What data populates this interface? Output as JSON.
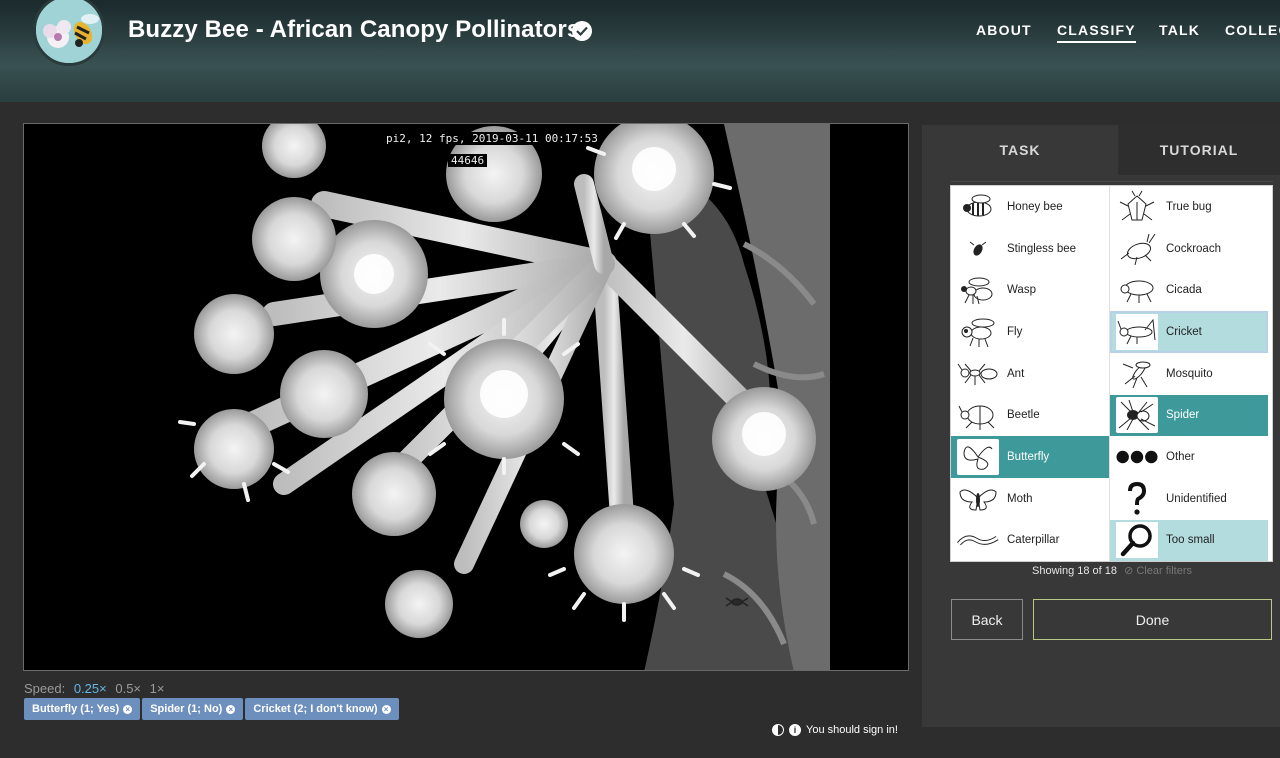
{
  "header": {
    "project_title": "Buzzy Bee - African Canopy Pollinators",
    "nav": [
      "ABOUT",
      "CLASSIFY",
      "TALK",
      "COLLEC"
    ],
    "active_nav": "CLASSIFY"
  },
  "subject": {
    "overlay_line1": "pi2, 12 fps, 2019-03-11 00:17:53",
    "overlay_line2": "44646"
  },
  "speed": {
    "label": "Speed:",
    "options": [
      "0.25×",
      "0.5×",
      "1×"
    ],
    "selected": "0.25×"
  },
  "annotations": [
    {
      "label": "Butterfly (1; Yes)"
    },
    {
      "label": "Spider (1; No)"
    },
    {
      "label": "Cricket (2; I don't know)"
    }
  ],
  "footer": {
    "signin": "You should sign in!"
  },
  "panel": {
    "tabs": [
      "TASK",
      "TUTORIAL"
    ],
    "choices_left": [
      {
        "label": "Honey bee",
        "icon": "honey-bee-icon"
      },
      {
        "label": "Stingless bee",
        "icon": "stingless-bee-icon"
      },
      {
        "label": "Wasp",
        "icon": "wasp-icon"
      },
      {
        "label": "Fly",
        "icon": "fly-icon"
      },
      {
        "label": "Ant",
        "icon": "ant-icon"
      },
      {
        "label": "Beetle",
        "icon": "beetle-icon"
      },
      {
        "label": "Butterfly",
        "icon": "butterfly-icon",
        "state": "selected"
      },
      {
        "label": "Moth",
        "icon": "moth-icon"
      },
      {
        "label": "Caterpillar",
        "icon": "caterpillar-icon"
      }
    ],
    "choices_right": [
      {
        "label": "True bug",
        "icon": "true-bug-icon"
      },
      {
        "label": "Cockroach",
        "icon": "cockroach-icon"
      },
      {
        "label": "Cicada",
        "icon": "cicada-icon"
      },
      {
        "label": "Cricket",
        "icon": "cricket-icon",
        "state": "light-focused"
      },
      {
        "label": "Mosquito",
        "icon": "mosquito-icon"
      },
      {
        "label": "Spider",
        "icon": "spider-icon",
        "state": "selected"
      },
      {
        "label": "Other",
        "icon": "dots-icon"
      },
      {
        "label": "Unidentified",
        "icon": "question-icon"
      },
      {
        "label": "Too small",
        "icon": "magnifier-icon",
        "state": "light"
      }
    ],
    "showing": "Showing 18 of 18",
    "clear_filters": "Clear filters",
    "back_label": "Back",
    "done_label": "Done"
  },
  "colors": {
    "accent_teal": "#3e9a9a",
    "light_teal": "#b3dcdf",
    "chip_blue": "#6d8fbd",
    "speed_active": "#5fb6e8",
    "done_border": "#b8c98a"
  }
}
